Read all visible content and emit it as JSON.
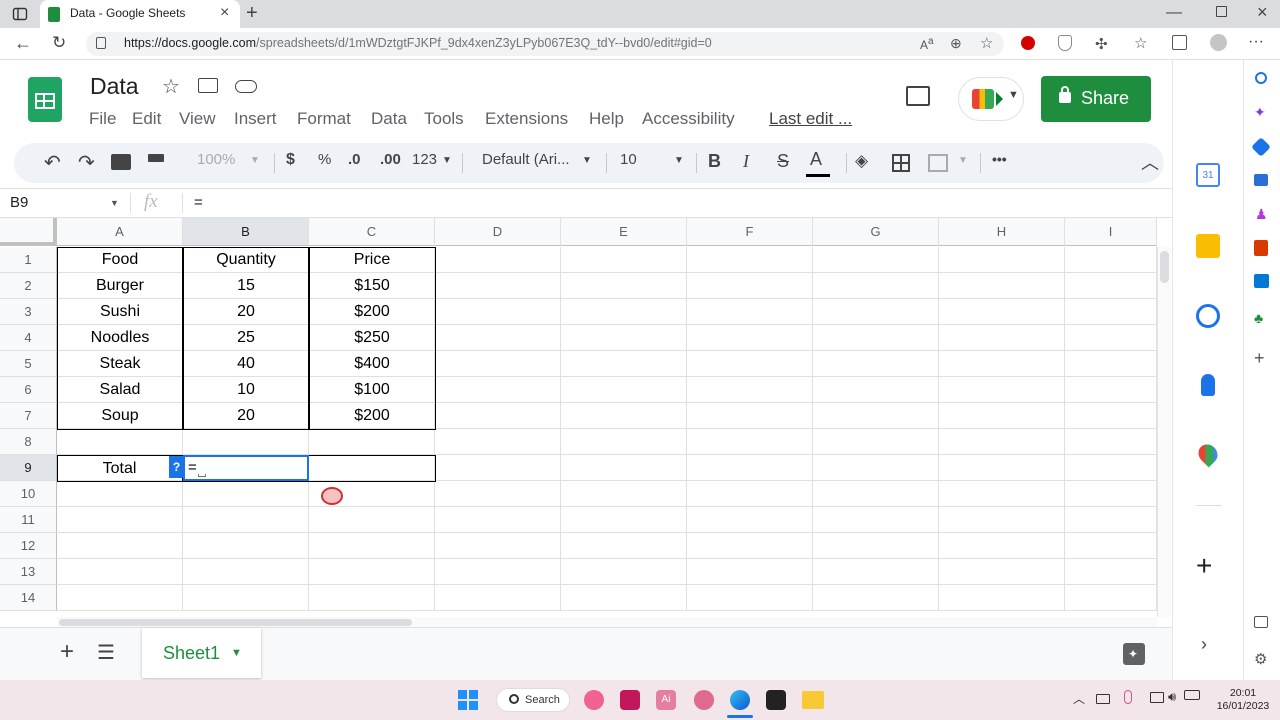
{
  "browser": {
    "tab_title": "Data - Google Sheets",
    "url_host": "https://docs.google.com",
    "url_path": "/spreadsheets/d/1mWDztgtFJKPf_9dx4xenZ3yLPyb067E3Q_tdY--bvd0/edit#gid=0"
  },
  "doc": {
    "title": "Data",
    "menu": [
      "File",
      "Edit",
      "View",
      "Insert",
      "Format",
      "Data",
      "Tools",
      "Extensions",
      "Help",
      "Accessibility"
    ],
    "last_edit": "Last edit ...",
    "share_label": "Share"
  },
  "toolbar": {
    "zoom": "100%",
    "currency": "$",
    "percent": "%",
    "dec_less": ".0",
    "dec_more": ".00",
    "number_format": "123",
    "font": "Default (Ari...",
    "font_size": "10",
    "bold": "B",
    "italic": "I",
    "strike": "S",
    "text_color": "A",
    "more": "•••"
  },
  "formula_bar": {
    "cell_ref": "B9",
    "fx": "fx",
    "content": "="
  },
  "grid": {
    "columns": [
      "A",
      "B",
      "C",
      "D",
      "E",
      "F",
      "G",
      "H",
      "I"
    ],
    "rows": [
      "1",
      "2",
      "3",
      "4",
      "5",
      "6",
      "7",
      "8",
      "9",
      "10",
      "11",
      "12",
      "13",
      "14"
    ],
    "table": [
      [
        "Food",
        "Quantity",
        "Price"
      ],
      [
        "Burger",
        "15",
        "$150"
      ],
      [
        "Sushi",
        "20",
        "$200"
      ],
      [
        "Noodles",
        "25",
        "$250"
      ],
      [
        "Steak",
        "40",
        "$400"
      ],
      [
        "Salad",
        "10",
        "$100"
      ],
      [
        "Soup",
        "20",
        "$200"
      ]
    ],
    "total_label": "Total",
    "active_cell_value": "=",
    "help_badge": "?"
  },
  "sheets": {
    "active": "Sheet1"
  },
  "taskbar": {
    "search_label": "Search",
    "time": "20:01",
    "date": "16/01/2023"
  },
  "colors": {
    "sheets_green": "#1e8e3e",
    "selection_blue": "#1a73e8",
    "toolbar_bg": "#eff3f8"
  }
}
